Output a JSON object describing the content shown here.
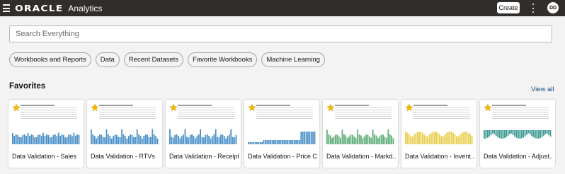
{
  "header": {
    "brand": "ORACLE",
    "product": "Analytics",
    "create_label": "Create",
    "avatar_initials": "DD",
    "menu_icon": "hamburger-icon",
    "more_icon": "kebab-icon",
    "background": "#312d2a"
  },
  "search": {
    "placeholder": "Search Everything",
    "value": ""
  },
  "chips": [
    "Workbooks and Reports",
    "Data",
    "Recent Datasets",
    "Favorite Workbooks",
    "Machine Learning"
  ],
  "favorites": {
    "title": "Favorites",
    "view_all": "View all",
    "star_color": "#f5b800",
    "cards": [
      {
        "label": "Data Validation - Sales",
        "chart": "blue-bars"
      },
      {
        "label": "Data Validation - RTVs",
        "chart": "blue-bars"
      },
      {
        "label": "Data Validation - Receipts",
        "chart": "blue-bars"
      },
      {
        "label": "Data Validation - Price C...",
        "chart": "blue-table"
      },
      {
        "label": "Data Validation - Markd...",
        "chart": "green-bars"
      },
      {
        "label": "Data Validation - Invent...",
        "chart": "yellow-bars"
      },
      {
        "label": "Data Validation - Adjust...",
        "chart": "teal-bars"
      }
    ]
  }
}
